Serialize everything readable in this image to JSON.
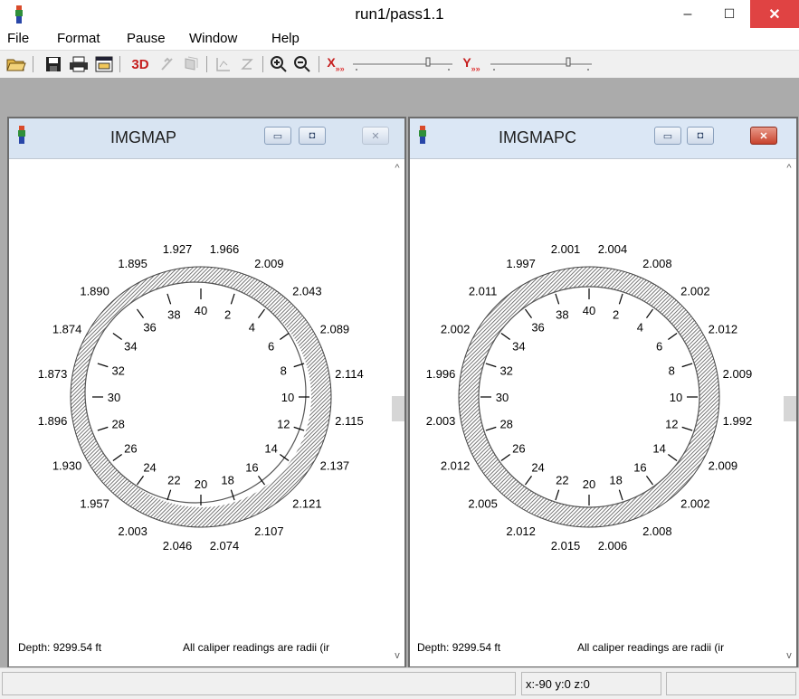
{
  "window": {
    "title": "run1/pass1.1",
    "minimize": "–",
    "maximize": "☐",
    "close": "✕"
  },
  "menu": [
    "File",
    "Format",
    "Pause",
    "Window",
    "Help"
  ],
  "toolbar": {
    "threed": "3D",
    "x_label": "X",
    "y_label": "Y"
  },
  "panes": [
    {
      "title": "IMGMAP",
      "depth": "Depth: 9299.54 ft",
      "note": "All caliper readings are radii (ir",
      "readings": [
        "1.966",
        "2.009",
        "2.043",
        "2.089",
        "2.114",
        "2.115",
        "2.137",
        "2.121",
        "2.107",
        "2.074",
        "2.046",
        "2.003",
        "1.957",
        "1.930",
        "1.896",
        "1.873",
        "1.874",
        "1.890",
        "1.895",
        "1.927"
      ],
      "ticks": [
        "2",
        "4",
        "6",
        "8",
        "10",
        "12",
        "14",
        "16",
        "18",
        "20",
        "22",
        "24",
        "26",
        "28",
        "30",
        "32",
        "34",
        "36",
        "38",
        "40"
      ]
    },
    {
      "title": "IMGMAPC",
      "depth": "Depth: 9299.54 ft",
      "note": "All caliper readings are radii (ir",
      "readings": [
        "2.004",
        "2.008",
        "2.002",
        "2.012",
        "2.009",
        "1.992",
        "2.009",
        "2.002",
        "2.008",
        "2.006",
        "2.015",
        "2.012",
        "2.005",
        "2.012",
        "2.003",
        "1.996",
        "2.002",
        "2.011",
        "1.997",
        "2.001"
      ],
      "ticks": [
        "2",
        "4",
        "6",
        "8",
        "10",
        "12",
        "14",
        "16",
        "18",
        "20",
        "22",
        "24",
        "26",
        "28",
        "30",
        "32",
        "34",
        "36",
        "38",
        "40"
      ]
    }
  ],
  "status": {
    "left": "",
    "coords": "x:-90 y:0 z:0",
    "right": ""
  }
}
